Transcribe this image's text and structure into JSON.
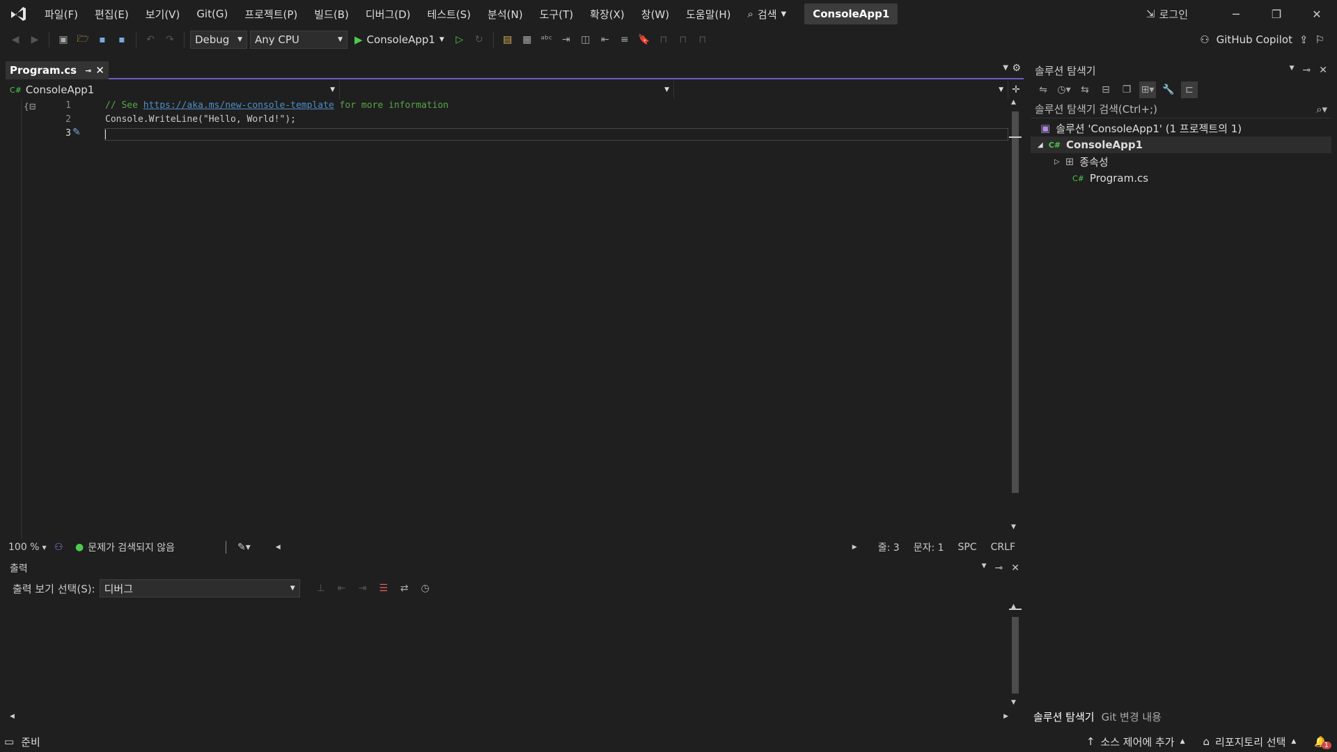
{
  "menu": [
    "파일(F)",
    "편집(E)",
    "보기(V)",
    "Git(G)",
    "프로젝트(P)",
    "빌드(B)",
    "디버그(D)",
    "테스트(S)",
    "분석(N)",
    "도구(T)",
    "확장(X)",
    "창(W)",
    "도움말(H)"
  ],
  "search_label": "검색",
  "solution_name": "ConsoleApp1",
  "login_label": "로그인",
  "toolbar": {
    "config": "Debug",
    "platform": "Any CPU",
    "run_target": "ConsoleApp1",
    "copilot": "GitHub Copilot"
  },
  "editor": {
    "tab_title": "Program.cs",
    "project_combo": "ConsoleApp1",
    "lines": [
      {
        "num": "1",
        "prefix": "// See ",
        "link": "https://aka.ms/new-console-template",
        "suffix": " for more information"
      },
      {
        "num": "2",
        "code": "Console.WriteLine(\"Hello, World!\");"
      },
      {
        "num": "3",
        "code": ""
      }
    ],
    "zoom": "100 %",
    "issues": "문제가 검색되지 않음",
    "line_col": "줄: 3",
    "char_col": "문자: 1",
    "whitespace": "SPC",
    "line_ending": "CRLF"
  },
  "output": {
    "title": "출력",
    "select_label": "출력 보기 선택(S):",
    "select_value": "디버그"
  },
  "solution_explorer": {
    "title": "솔루션 탐색기",
    "search_placeholder": "솔루션 탐색기 검색(Ctrl+;)",
    "tree": {
      "solution": "솔루션 'ConsoleApp1' (1 프로젝트의 1)",
      "project": "ConsoleApp1",
      "dependencies": "종속성",
      "file": "Program.cs"
    },
    "tabs": [
      "솔루션 탐색기",
      "Git 변경 내용"
    ]
  },
  "status": {
    "ready": "준비",
    "source_control": "소스 제어에 추가",
    "repository": "리포지토리 선택",
    "notifications": "1"
  },
  "colors": {
    "accent": "#6c5fc7",
    "background": "#1f1f1f",
    "comment": "#57a64a",
    "link": "#4e8ec8",
    "run_green": "#4ec94e"
  }
}
